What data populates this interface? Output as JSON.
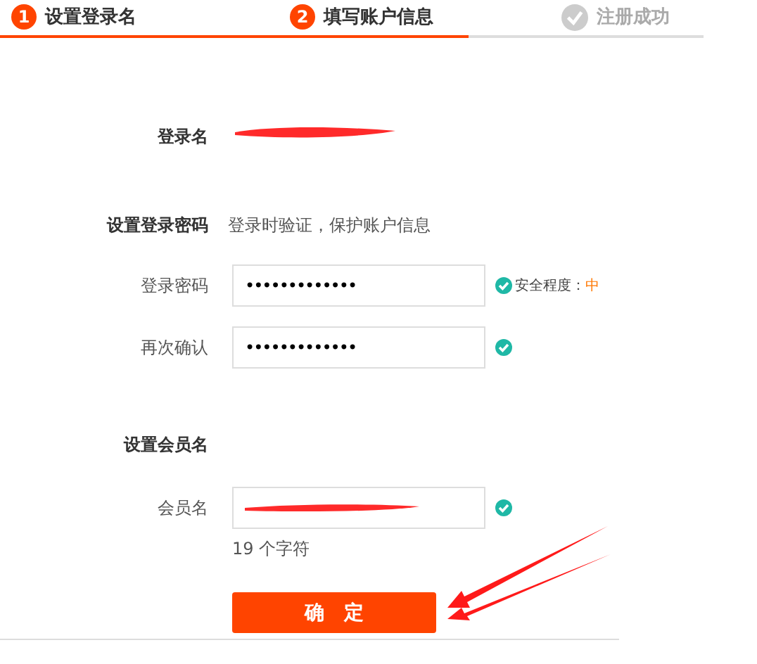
{
  "steps": [
    {
      "kind": "number",
      "number": "1",
      "label": "设置登录名",
      "active": true
    },
    {
      "kind": "number",
      "number": "2",
      "label": "填写账户信息",
      "active": true
    },
    {
      "kind": "check",
      "label": "注册成功",
      "active": false
    }
  ],
  "login_name": {
    "label": "登录名"
  },
  "password_section": {
    "title": "设置登录密码",
    "hint": "登录时验证，保护账户信息"
  },
  "password_fields": [
    {
      "label": "登录密码",
      "value": "•••••••••••••",
      "valid": true,
      "strength_label": "安全程度：",
      "strength": "中"
    },
    {
      "label": "再次确认",
      "value": "•••••••••••••",
      "valid": true
    }
  ],
  "member_section": {
    "title": "设置会员名"
  },
  "member_field": {
    "label": "会员名",
    "valid": true,
    "hint": "19 个字符"
  },
  "submit": {
    "label": "确　定"
  }
}
